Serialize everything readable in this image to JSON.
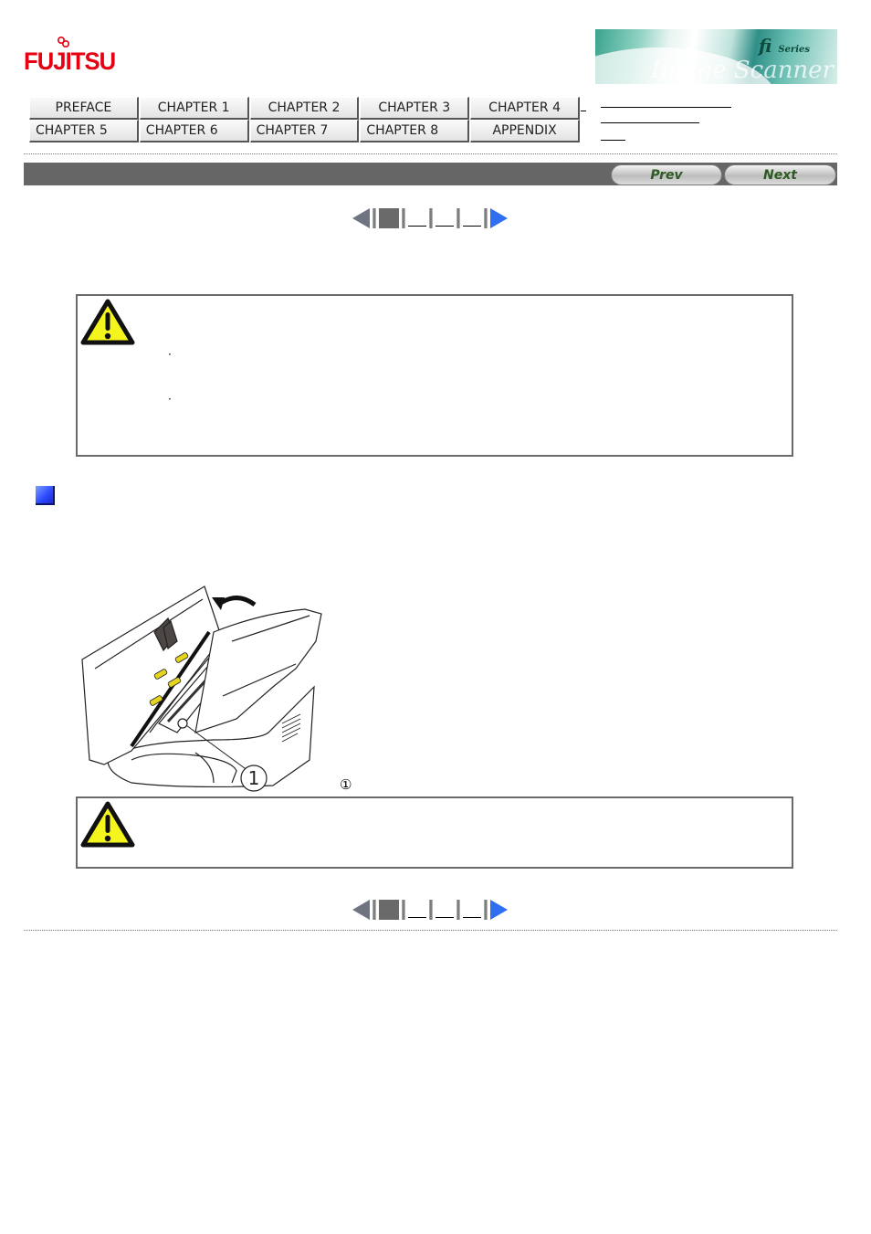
{
  "header": {
    "logo_text": "FUJITSU",
    "banner": {
      "brand": "fi",
      "series": "Series",
      "product": "Image Scanner"
    }
  },
  "nav": {
    "row1": [
      "PREFACE",
      "CHAPTER 1",
      "CHAPTER 2",
      "CHAPTER 3",
      "CHAPTER 4"
    ],
    "row2": [
      "CHAPTER 5",
      "CHAPTER 6",
      "CHAPTER 7",
      "CHAPTER 8",
      "APPENDIX"
    ],
    "side_links": [
      "",
      "",
      ""
    ]
  },
  "titlebar": {
    "title": "",
    "prev_label": "Prev",
    "next_label": "Next"
  },
  "pager": {
    "current_page": 1,
    "page_links": [
      "",
      "",
      ""
    ]
  },
  "caution_1": {
    "icon": "warning-triangle-icon",
    "heading": "",
    "bullets": [
      "",
      ""
    ]
  },
  "section": {
    "icon": "blue-square-icon",
    "heading": "",
    "body": ""
  },
  "figure": {
    "callout_number": "1",
    "caption_marker": "①",
    "caption_text": ""
  },
  "caution_2": {
    "icon": "warning-triangle-icon",
    "text": ""
  },
  "colors": {
    "logo_red": "#e60012",
    "titlebar_gray": "#666666",
    "next_arrow_blue": "#2f6ef0",
    "prev_arrow_gray": "#6e7580",
    "warning_yellow": "#f5f51e",
    "section_blue": "#2c48ff"
  }
}
